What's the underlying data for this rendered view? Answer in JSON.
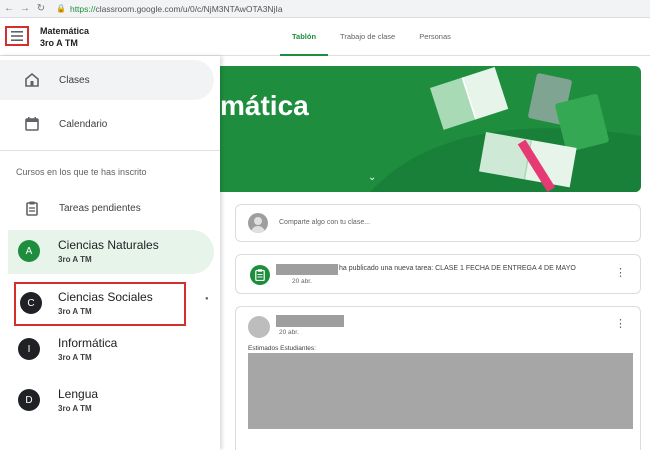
{
  "browser": {
    "url_scheme": "https://",
    "url_rest": "classroom.google.com/u/0/c/NjM3NTAwOTA3NjIa"
  },
  "header": {
    "course_title": "Matemática",
    "course_section": "3ro A TM",
    "tabs": [
      {
        "label": "Tablón",
        "active": true
      },
      {
        "label": "Trabajo de clase",
        "active": false
      },
      {
        "label": "Personas",
        "active": false
      }
    ]
  },
  "sidebar": {
    "classes_label": "Clases",
    "calendar_label": "Calendario",
    "enrolled_section_label": "Cursos en los que te has inscrito",
    "pending_label": "Tareas pendientes",
    "courses": [
      {
        "initial": "A",
        "name": "Ciencias Naturales",
        "section": "3ro A TM",
        "color": "#1e8e3e"
      },
      {
        "initial": "C",
        "name": "Ciencias Sociales",
        "section": "3ro A TM",
        "color": "#202124"
      },
      {
        "initial": "I",
        "name": "Informática",
        "section": "3ro A TM",
        "color": "#202124"
      },
      {
        "initial": "D",
        "name": "Lengua",
        "section": "3ro A TM",
        "color": "#202124"
      }
    ]
  },
  "main": {
    "banner_title": "mática",
    "compose_placeholder": "Comparte algo con tu clase...",
    "task_post": {
      "text": "ha publicado una nueva tarea: CLASE 1 FECHA DE ENTREGA 4 DE MAYO",
      "date": "20 abr."
    },
    "announcement": {
      "date": "20 abr.",
      "greeting": "Estimados Estudiantes:"
    }
  },
  "colors": {
    "brand_green": "#1e8e3e",
    "highlight_red": "#d32f2f"
  }
}
